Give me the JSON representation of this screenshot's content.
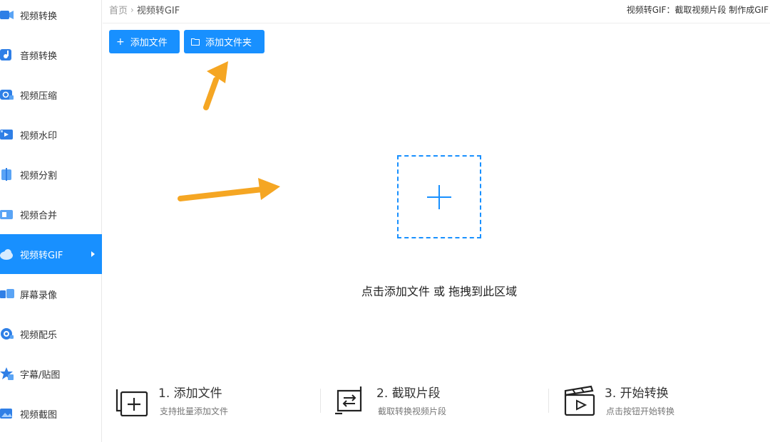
{
  "sidebar": {
    "items": [
      {
        "label": "视频转换",
        "icon": "video-convert-icon",
        "active": false
      },
      {
        "label": "音频转换",
        "icon": "audio-convert-icon",
        "active": false
      },
      {
        "label": "视频压缩",
        "icon": "video-compress-icon",
        "active": false
      },
      {
        "label": "视频水印",
        "icon": "video-watermark-icon",
        "active": false
      },
      {
        "label": "视频分割",
        "icon": "video-split-icon",
        "active": false
      },
      {
        "label": "视频合并",
        "icon": "video-merge-icon",
        "active": false
      },
      {
        "label": "视频转GIF",
        "icon": "video-to-gif-icon",
        "active": true
      },
      {
        "label": "屏幕录像",
        "icon": "screen-record-icon",
        "active": false
      },
      {
        "label": "视频配乐",
        "icon": "video-music-icon",
        "active": false
      },
      {
        "label": "字幕/贴图",
        "icon": "subtitle-sticker-icon",
        "active": false
      },
      {
        "label": "视频截图",
        "icon": "video-screenshot-icon",
        "active": false
      }
    ]
  },
  "header": {
    "breadcrumb_home": "首页",
    "breadcrumb_current": "视频转GIF",
    "hint": "视频转GIF：截取视频片段 制作成GIF"
  },
  "toolbar": {
    "add_file_label": "添加文件",
    "add_folder_label": "添加文件夹"
  },
  "dropzone": {
    "text": "点击添加文件 或 拖拽到此区域"
  },
  "steps": [
    {
      "title": "1. 添加文件",
      "desc": "支持批量添加文件",
      "icon": "add-file-icon"
    },
    {
      "title": "2. 截取片段",
      "desc": "截取转换视频片段",
      "icon": "clip-segment-icon"
    },
    {
      "title": "3. 开始转换",
      "desc": "点击按钮开始转换",
      "icon": "clapperboard-icon"
    }
  ],
  "colors": {
    "accent": "#1890ff",
    "annotation_arrow": "#f5a623"
  }
}
